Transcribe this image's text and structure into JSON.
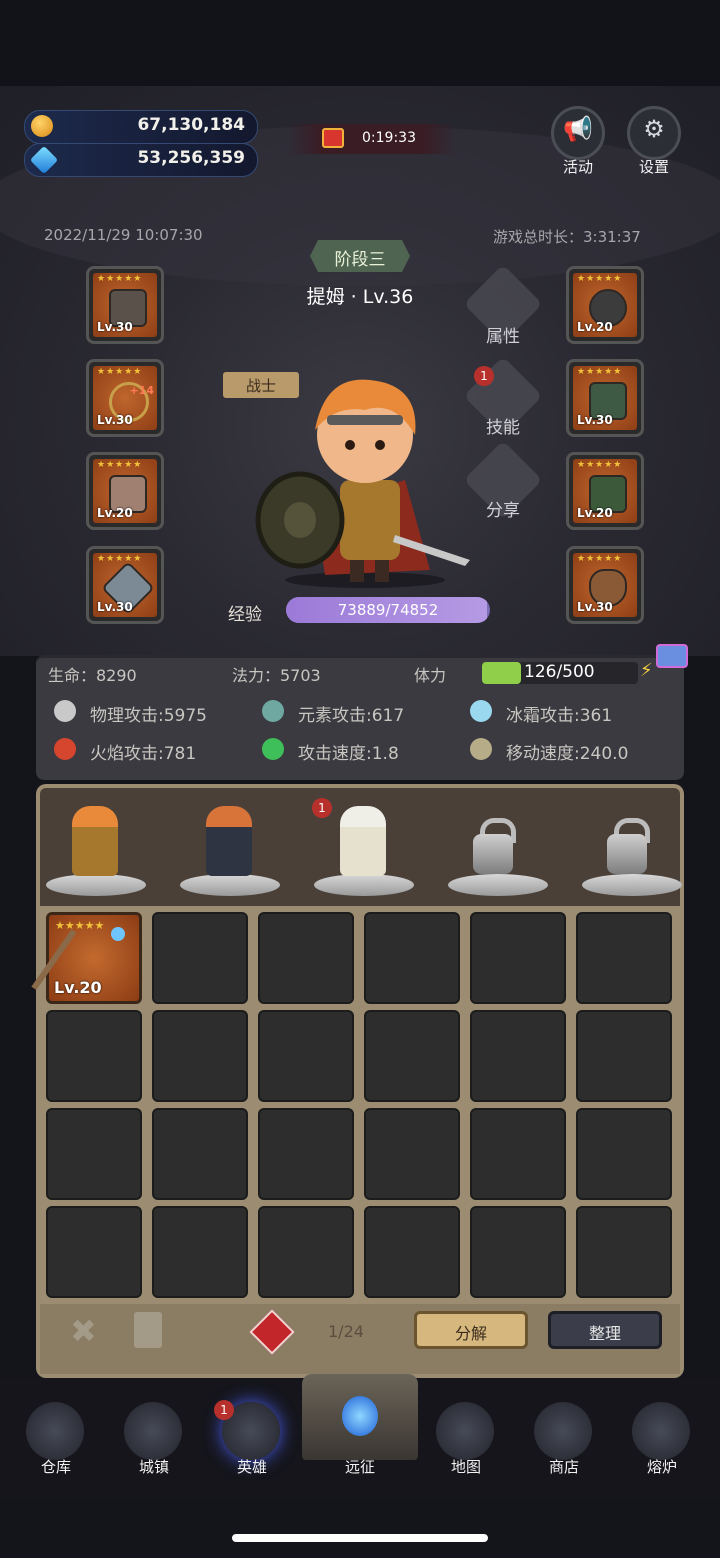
{
  "currency": {
    "gold": "67,130,184",
    "gems": "53,256,359"
  },
  "timer": "0:19:33",
  "top_buttons": {
    "activity": "活动",
    "settings": "设置"
  },
  "datetime": "2022/11/29 10:07:30",
  "playtime": "游戏总时长：3:31:37",
  "hero": {
    "stage": "阶段三",
    "name": "提姆 · Lv.36",
    "class": "战士"
  },
  "left_equipment": [
    {
      "level": "Lv.30",
      "stars": "★★★★★",
      "item": "helmet-icon"
    },
    {
      "level": "Lv.30",
      "stars": "★★★★★",
      "plus": "+14",
      "item": "necklace-icon"
    },
    {
      "level": "Lv.20",
      "stars": "★★★★★",
      "item": "gloves-icon"
    },
    {
      "level": "Lv.30",
      "stars": "★★★★★",
      "item": "weapon-icon"
    }
  ],
  "right_equipment": [
    {
      "level": "Lv.20",
      "stars": "★★★★★",
      "item": "ring-icon"
    },
    {
      "level": "Lv.30",
      "stars": "★★★★★",
      "item": "armor-icon"
    },
    {
      "level": "Lv.20",
      "stars": "★★★★★",
      "item": "boots-icon"
    },
    {
      "level": "Lv.30",
      "stars": "★★★★★",
      "item": "shield-icon"
    }
  ],
  "side_actions": {
    "attributes": "属性",
    "skills": "技能",
    "skills_badge": "1",
    "share": "分享"
  },
  "experience": {
    "label": "经验",
    "text": "73889/74852",
    "current": 73889,
    "max": 74852
  },
  "stats_top": {
    "hp": "生命：8290",
    "mp": "法力：5703",
    "stamina_label": "体力",
    "stamina_text": "126/500",
    "stamina_current": 126,
    "stamina_max": 500
  },
  "stats": [
    "物理攻击:5975",
    "元素攻击:617",
    "冰霜攻击:361",
    "火焰攻击:781",
    "攻击速度:1.8",
    "移动速度:240.0"
  ],
  "roster": {
    "badge": "1"
  },
  "inventory": {
    "item": {
      "level": "Lv.20",
      "stars": "★★★★★"
    },
    "count": "1/24",
    "decompose": "分解",
    "sort": "整理"
  },
  "nav": {
    "badge": "1",
    "items": [
      "仓库",
      "城镇",
      "英雄",
      "远征",
      "地图",
      "商店",
      "熔炉"
    ]
  },
  "colors": {
    "accent": "#7d6cb8",
    "stamina": "#8fcf4a",
    "slot": "#b45a26"
  }
}
